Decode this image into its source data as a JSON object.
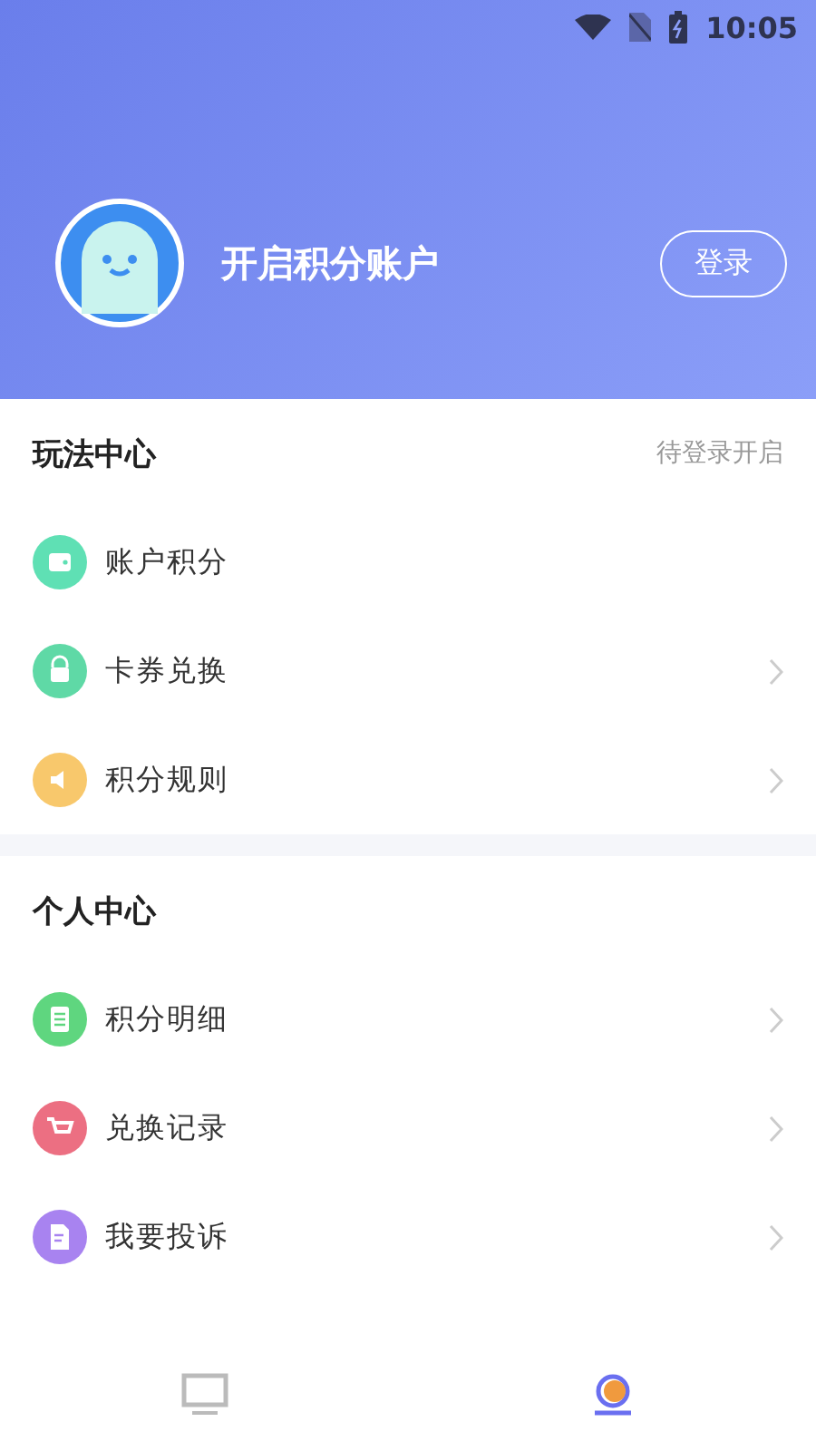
{
  "status_bar": {
    "time": "10:05"
  },
  "profile": {
    "title": "开启积分账户",
    "login_button": "登录"
  },
  "sections": [
    {
      "title": "玩法中心",
      "note": "待登录开启",
      "items": [
        {
          "label": "账户积分",
          "kind": "wallet",
          "color": "#5fe0b4",
          "has_arrow": false
        },
        {
          "label": "卡券兑换",
          "kind": "lock",
          "color": "#5fd9a6",
          "has_arrow": true
        },
        {
          "label": "积分规则",
          "kind": "speaker",
          "color": "#f8c86c",
          "has_arrow": true
        }
      ]
    },
    {
      "title": "个人中心",
      "items": [
        {
          "label": "积分明细",
          "kind": "list",
          "color": "#5fd67f",
          "has_arrow": true
        },
        {
          "label": "兑换记录",
          "kind": "cart",
          "color": "#ec6f82",
          "has_arrow": true
        },
        {
          "label": "我要投诉",
          "kind": "document",
          "color": "#a883f0",
          "has_arrow": true
        }
      ]
    }
  ],
  "tabs": [
    {
      "kind": "monitor",
      "selected": false
    },
    {
      "kind": "profile",
      "selected": true
    }
  ]
}
